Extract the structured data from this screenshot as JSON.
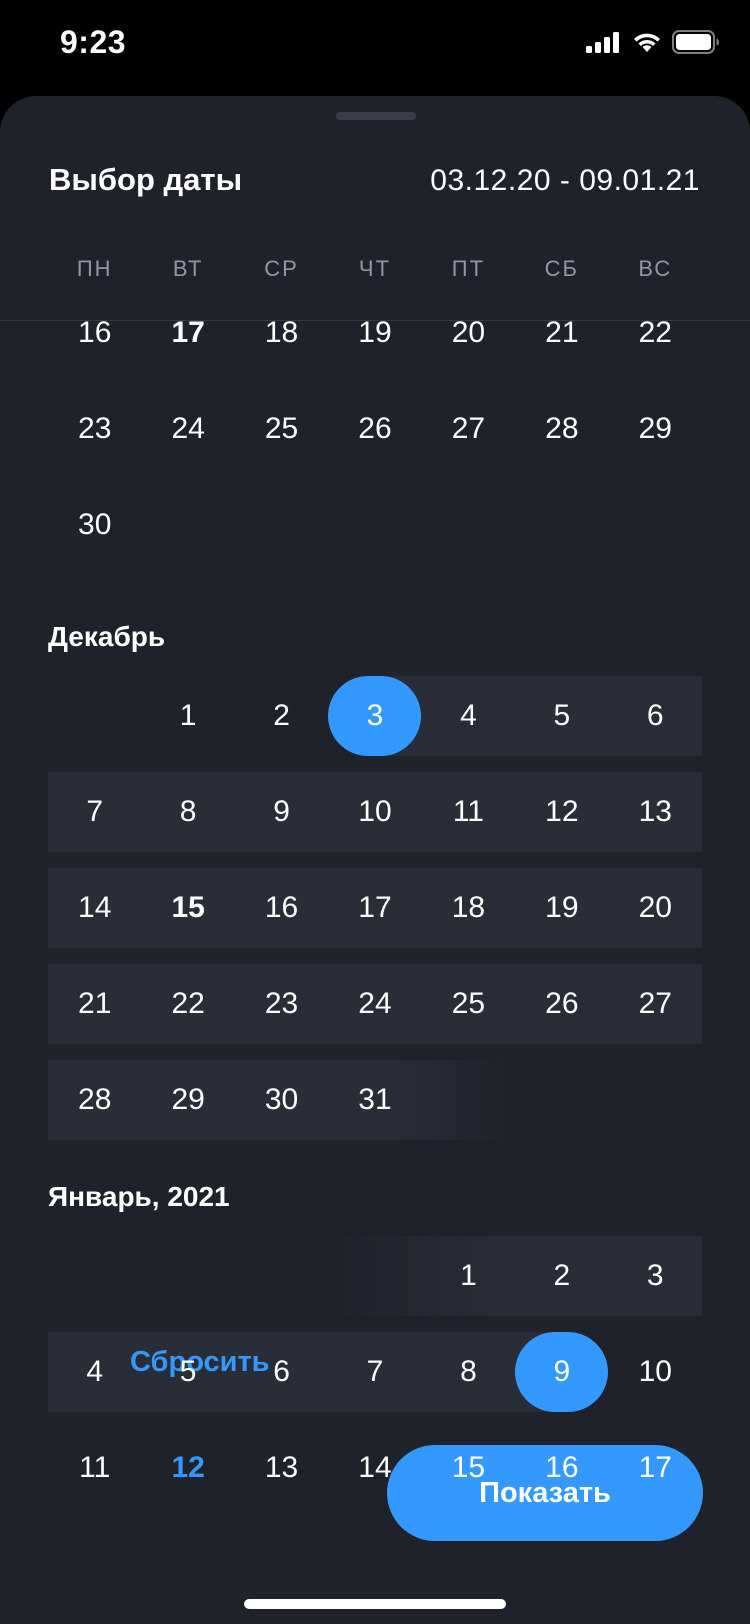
{
  "status": {
    "time": "9:23",
    "icons": [
      "cellular-signal-icon",
      "wifi-icon",
      "battery-icon"
    ]
  },
  "header": {
    "title": "Выбор даты",
    "range": "03.12.20 - 09.01.21"
  },
  "weekdays": [
    "ПН",
    "ВТ",
    "СР",
    "ЧТ",
    "ПТ",
    "СБ",
    "ВС"
  ],
  "months": [
    {
      "title": "",
      "weeks": [
        [
          {
            "d": "16"
          },
          {
            "d": "17",
            "today": true
          },
          {
            "d": "18"
          },
          {
            "d": "19"
          },
          {
            "d": "20"
          },
          {
            "d": "21"
          },
          {
            "d": "22"
          }
        ],
        [
          {
            "d": "23"
          },
          {
            "d": "24"
          },
          {
            "d": "25"
          },
          {
            "d": "26"
          },
          {
            "d": "27"
          },
          {
            "d": "28"
          },
          {
            "d": "29"
          }
        ],
        [
          {
            "d": "30"
          }
        ]
      ]
    },
    {
      "title": "Декабрь",
      "weeks": [
        [
          null,
          {
            "d": "1"
          },
          {
            "d": "2"
          },
          {
            "d": "3",
            "selected": true
          },
          {
            "d": "4"
          },
          {
            "d": "5"
          },
          {
            "d": "6"
          }
        ],
        [
          {
            "d": "7"
          },
          {
            "d": "8"
          },
          {
            "d": "9"
          },
          {
            "d": "10"
          },
          {
            "d": "11"
          },
          {
            "d": "12"
          },
          {
            "d": "13"
          }
        ],
        [
          {
            "d": "14"
          },
          {
            "d": "15",
            "today": true
          },
          {
            "d": "16"
          },
          {
            "d": "17"
          },
          {
            "d": "18"
          },
          {
            "d": "19"
          },
          {
            "d": "20"
          }
        ],
        [
          {
            "d": "21"
          },
          {
            "d": "22"
          },
          {
            "d": "23"
          },
          {
            "d": "24"
          },
          {
            "d": "25"
          },
          {
            "d": "26"
          },
          {
            "d": "27"
          }
        ],
        [
          {
            "d": "28"
          },
          {
            "d": "29"
          },
          {
            "d": "30"
          },
          {
            "d": "31"
          }
        ]
      ]
    },
    {
      "title": "Январь, 2021",
      "weeks": [
        [
          null,
          null,
          null,
          null,
          {
            "d": "1"
          },
          {
            "d": "2"
          },
          {
            "d": "3"
          }
        ],
        [
          {
            "d": "4"
          },
          {
            "d": "5"
          },
          {
            "d": "6"
          },
          {
            "d": "7"
          },
          {
            "d": "8"
          },
          {
            "d": "9",
            "selected": true
          },
          {
            "d": "10"
          }
        ],
        [
          {
            "d": "11"
          },
          {
            "d": "12",
            "today": true
          },
          {
            "d": "13"
          },
          {
            "d": "14"
          },
          {
            "d": "15"
          },
          {
            "d": "16"
          },
          {
            "d": "17"
          }
        ]
      ]
    }
  ],
  "actions": {
    "reset": "Сбросить",
    "show": "Показать"
  },
  "colors": {
    "accent": "#3399ff",
    "sheet": "#1f222b",
    "range_band": "#292d37"
  }
}
